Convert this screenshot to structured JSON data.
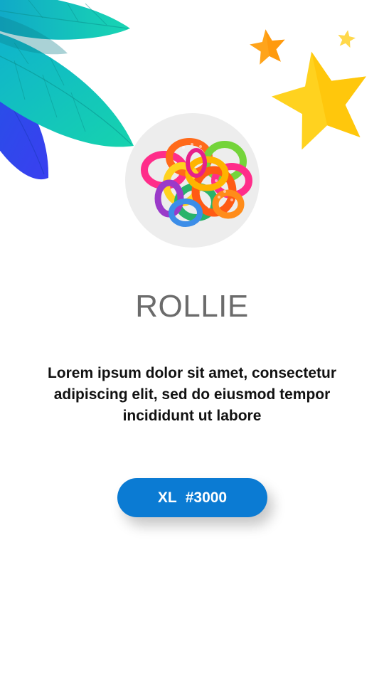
{
  "product": {
    "name": "ROLLIE",
    "image": "colorful-baby-rings-toy",
    "description": "Lorem ipsum dolor sit amet, consectetur adipiscing elit, sed do eiusmod tempor incididunt ut labore"
  },
  "price_button": {
    "size": "XL",
    "price": "#3000",
    "color": "#0b7bd3"
  },
  "decorations": {
    "leaves_icon": "leaves-icon",
    "stars_icon": "stars-icon",
    "leaf_colors": [
      "#1bc7b6",
      "#10b7c4",
      "#3049e8"
    ],
    "star_colors": [
      "#ffcc1a",
      "#ffa41b",
      "#ffd84a"
    ]
  }
}
